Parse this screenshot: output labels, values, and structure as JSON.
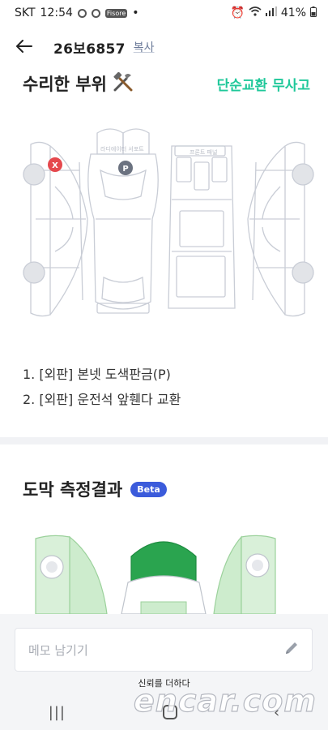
{
  "status_bar": {
    "carrier": "SKT",
    "time": "12:54",
    "small_badge": "Fisore",
    "battery": "41%"
  },
  "header": {
    "car_number": "26보6857",
    "copy_label": "복사"
  },
  "repair_section": {
    "title": "수리한 부위",
    "status": "단순교환 무사고",
    "diagram_labels": {
      "radiator_support": "라디에이터 서포트",
      "front_panel": "프론트 패널"
    },
    "markers": {
      "exchange": "X",
      "paint": "P"
    },
    "items": [
      "1. [외판] 본넷 도색판금(P)",
      "2. [외판] 운전석 앞휀다 교환"
    ]
  },
  "coating_section": {
    "title": "도막 측정결과",
    "badge": "Beta"
  },
  "memo": {
    "placeholder": "메모 남기기"
  },
  "footer": {
    "trust_text": "신뢰를 더하다",
    "watermark": "encar.com"
  },
  "colors": {
    "accent_green": "#1fc89a",
    "beta_blue": "#3b5bdb",
    "exchange_red": "#e5484d",
    "paint_gray": "#6b7280",
    "coat_dark_green": "#2aa44f",
    "coat_light_green": "#cdeccd"
  }
}
